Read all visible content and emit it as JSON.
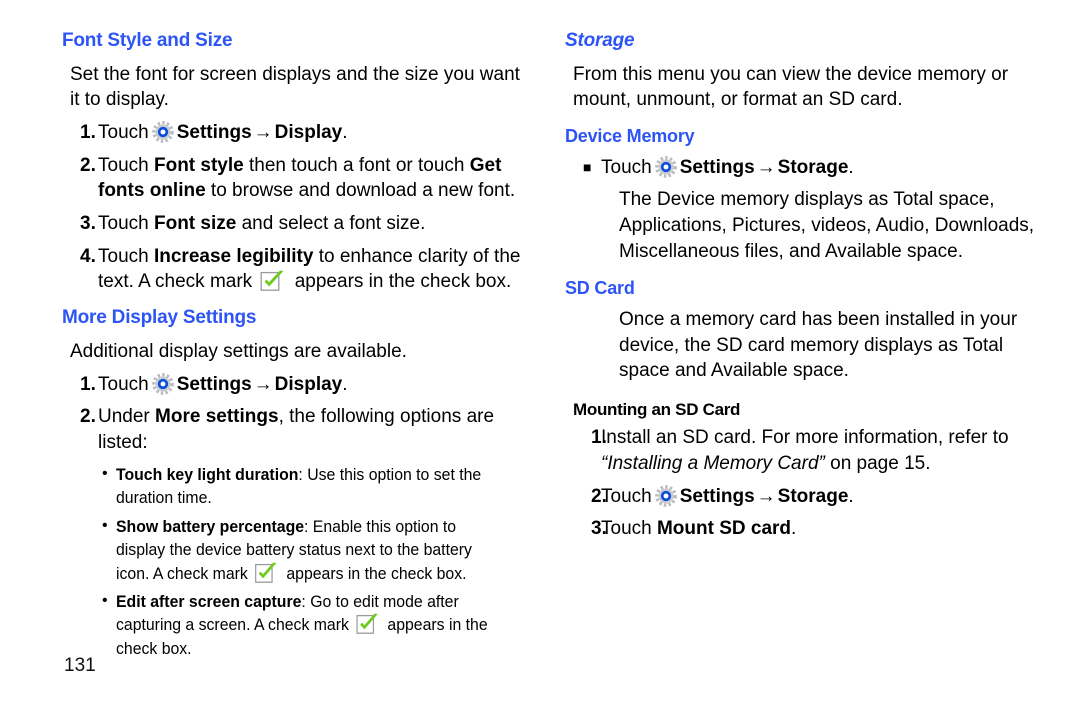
{
  "page": {
    "number": "131",
    "background": "#ffffff",
    "heading_color": "#2d55f5",
    "text_color": "#000000"
  },
  "icons": {
    "gear": "settings-gear-icon",
    "gear_ring_color": "#0a4ddb",
    "gear_body_color": "#b9bcc2",
    "checkbox": "green-checkmark-checkbox-icon",
    "check_color": "#6ecb1e",
    "checkbox_border": "#9a9a9a",
    "arrow": "→",
    "square_bullet": "■",
    "round_bullet": "•"
  },
  "left_column": {
    "section1": {
      "heading": "Font Style and Size",
      "intro": "Set the font for screen displays and the size you want it to display.",
      "steps": [
        {
          "num": "1.",
          "pre": "Touch",
          "icon": "gear",
          "bold1": "Settings",
          "arrow": "→",
          "bold2": "Display",
          "post": "."
        },
        {
          "num": "2.",
          "pre": "Touch ",
          "bold1": "Font style",
          "mid": " then touch a font or touch ",
          "bold2": "Get fonts online",
          "post": " to browse and download a new font."
        },
        {
          "num": "3.",
          "pre": "Touch ",
          "bold1": "Font size",
          "post": " and select a font size."
        },
        {
          "num": "4.",
          "pre": "Touch ",
          "bold1": "Increase legibility",
          "mid": " to enhance clarity of the text. A check mark ",
          "icon": "checkbox",
          "post": " appears in the check box."
        }
      ]
    },
    "section2": {
      "heading": "More Display Settings",
      "intro": "Additional display settings are available.",
      "steps": [
        {
          "num": "1.",
          "pre": "Touch",
          "icon": "gear",
          "bold1": "Settings",
          "arrow": "→",
          "bold2": "Display",
          "post": "."
        },
        {
          "num": "2.",
          "pre": "Under ",
          "bold1": "More settings",
          "post": ", the following options are listed:"
        }
      ],
      "sub_bullets": [
        {
          "bold": "Touch key light duration",
          "text": ": Use this option to set the duration time."
        },
        {
          "bold": "Show battery percentage",
          "text": ": Enable this option to display the device battery status next to the battery icon. A check mark ",
          "icon": "checkbox",
          "text_after": " appears in the check box."
        },
        {
          "bold": "Edit after screen capture",
          "text": ": Go to edit mode after capturing a screen. A check mark ",
          "icon": "checkbox",
          "text_after": " appears in the check box."
        }
      ]
    }
  },
  "right_column": {
    "section1": {
      "heading": "Storage",
      "heading_style": "italic",
      "intro": "From this menu you can view the device memory or mount, unmount, or format an SD card.",
      "sub1": {
        "heading": "Device Memory",
        "bullet": {
          "marker": "■",
          "pre": "Touch",
          "icon": "gear",
          "bold1": "Settings",
          "arrow": "→",
          "bold2": "Storage",
          "post": "."
        },
        "detail": "The Device memory displays as Total space, Applications, Pictures, videos, Audio, Downloads, Miscellaneous files, and Available space."
      },
      "sub2": {
        "heading": "SD Card",
        "detail": "Once a memory card has been installed in your device, the SD card memory displays as Total space and Available space."
      },
      "sub3": {
        "heading": "Mounting an SD Card",
        "steps": [
          {
            "num": "1.",
            "pre": "Install an SD card. For more information, refer to ",
            "italic": "“Installing a Memory Card”",
            "post": " on page 15."
          },
          {
            "num": "2.",
            "pre": "Touch",
            "icon": "gear",
            "bold1": "Settings",
            "arrow": "→",
            "bold2": "Storage",
            "post": "."
          },
          {
            "num": "3.",
            "pre": "Touch ",
            "bold1": "Mount SD card",
            "post": "."
          }
        ]
      }
    }
  }
}
